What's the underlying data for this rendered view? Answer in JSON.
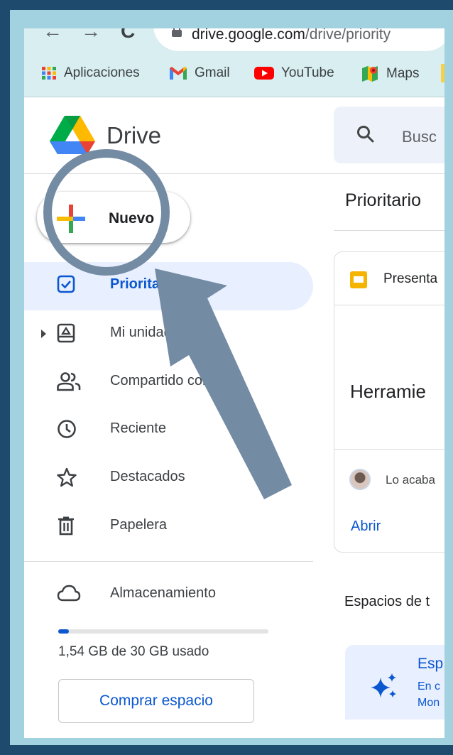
{
  "browser": {
    "url_host": "drive.google.com",
    "url_path": "/drive/priority",
    "back_glyph": "←",
    "forward_glyph": "→",
    "reload_glyph": "C",
    "bookmarks": [
      {
        "label": "Aplicaciones",
        "icon": "apps-grid-icon"
      },
      {
        "label": "Gmail",
        "icon": "gmail-icon"
      },
      {
        "label": "YouTube",
        "icon": "youtube-icon"
      },
      {
        "label": "Maps",
        "icon": "maps-icon"
      }
    ]
  },
  "header": {
    "app_name": "Drive",
    "search_placeholder": "Busc"
  },
  "sidebar": {
    "new_label": "Nuevo",
    "items": [
      {
        "label": "Prioritario",
        "icon": "priority-check-icon",
        "active": true
      },
      {
        "label": "Mi unidad",
        "icon": "my-drive-icon"
      },
      {
        "label": "Compartido conmigo",
        "icon": "shared-people-icon"
      },
      {
        "label": "Reciente",
        "icon": "clock-icon"
      },
      {
        "label": "Destacados",
        "icon": "star-icon"
      },
      {
        "label": "Papelera",
        "icon": "trash-icon"
      }
    ],
    "storage_label": "Almacenamiento",
    "storage_usage": "1,54 GB de 30 GB usado",
    "storage_fraction": 0.051,
    "buy_storage_label": "Comprar espacio"
  },
  "main": {
    "page_title": "Prioritario",
    "file_card": {
      "type_label": "Presenta",
      "title": "Herramie",
      "activity": "Lo acaba",
      "open_label": "Abrir"
    },
    "spaces_heading": "Espacios de t",
    "space_card": {
      "title": "Esp",
      "line1": "En c",
      "line2": "Mon"
    }
  },
  "colors": {
    "outer_background": "#1e4a6e",
    "frame": "#a2d1e0",
    "accent_blue": "#0b57d0",
    "annotation": "#738ba3"
  }
}
